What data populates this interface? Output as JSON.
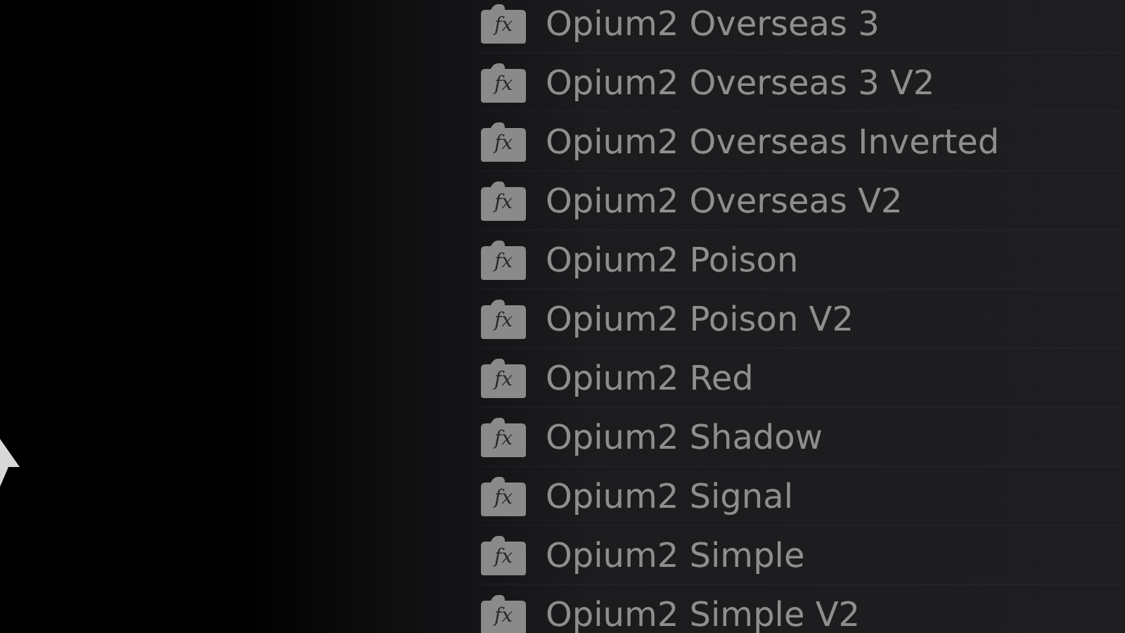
{
  "effects": [
    {
      "badge": "fx",
      "name": "Opium2 Overseas 3"
    },
    {
      "badge": "fx",
      "name": "Opium2 Overseas 3 V2"
    },
    {
      "badge": "fx",
      "name": "Opium2 Overseas Inverted"
    },
    {
      "badge": "fx",
      "name": "Opium2 Overseas V2"
    },
    {
      "badge": "fx",
      "name": "Opium2 Poison"
    },
    {
      "badge": "fx",
      "name": "Opium2 Poison V2"
    },
    {
      "badge": "fx",
      "name": "Opium2 Red"
    },
    {
      "badge": "fx",
      "name": "Opium2 Shadow"
    },
    {
      "badge": "fx",
      "name": "Opium2 Signal"
    },
    {
      "badge": "fx",
      "name": "Opium2 Simple"
    },
    {
      "badge": "fx",
      "name": "Opium2 Simple V2"
    }
  ]
}
